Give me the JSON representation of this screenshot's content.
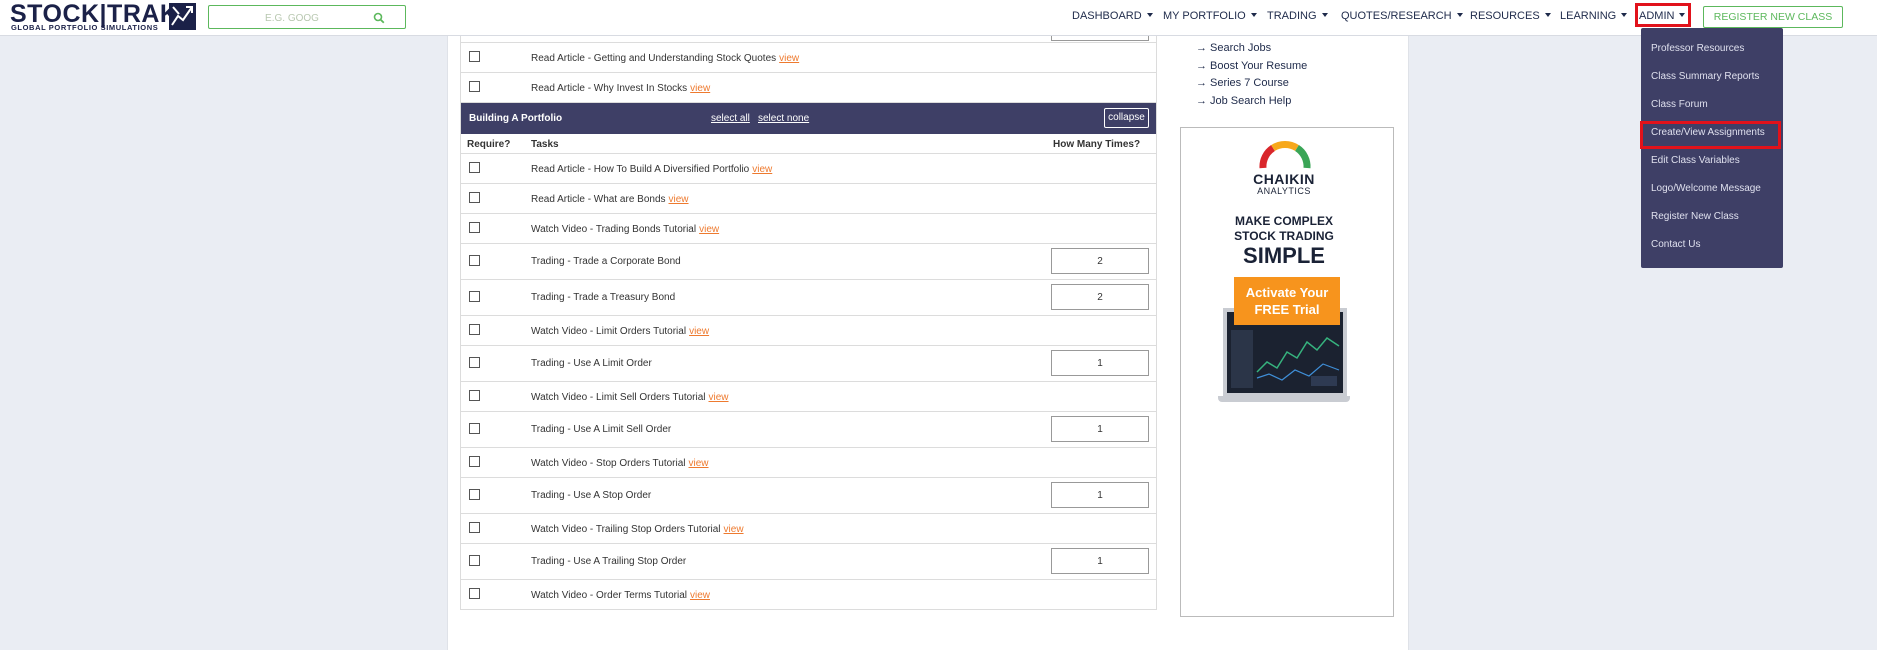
{
  "logo": {
    "word": "STOCK|TRAK",
    "tagline": "GLOBAL PORTFOLIO SIMULATIONS"
  },
  "search": {
    "placeholder": "E.G. GOOG",
    "icon": "search-icon"
  },
  "nav": {
    "items": [
      "DASHBOARD",
      "MY PORTFOLIO",
      "TRADING",
      "QUOTES/RESEARCH",
      "RESOURCES",
      "LEARNING",
      "ADMIN"
    ],
    "register_label": "REGISTER NEW CLASS"
  },
  "admin_menu": {
    "items": [
      "Professor Resources",
      "Class Summary Reports",
      "Class Forum",
      "Create/View Assignments",
      "Edit Class Variables",
      "Logo/Welcome Message",
      "Register New Class",
      "Contact Us"
    ],
    "highlighted": "Create/View Assignments"
  },
  "tasks_before": [
    {
      "text": "Read Article - Getting and Understanding Stock Quotes",
      "link": "view"
    },
    {
      "text": "Read Article - Why Invest In Stocks",
      "link": "view"
    }
  ],
  "section": {
    "title": "Building A Portfolio",
    "select_all": "select all",
    "select_none": "select none",
    "collapse": "collapse",
    "columns": {
      "require": "Require?",
      "tasks": "Tasks",
      "times": "How Many Times?"
    },
    "tasks": [
      {
        "text": "Read Article - How To Build A Diversified Portfolio",
        "link": "view",
        "times": null
      },
      {
        "text": "Read Article - What are Bonds",
        "link": "view",
        "times": null
      },
      {
        "text": "Watch Video - Trading Bonds Tutorial",
        "link": "view",
        "times": null
      },
      {
        "text": "Trading - Trade a Corporate Bond",
        "link": null,
        "times": "2"
      },
      {
        "text": "Trading - Trade a Treasury Bond",
        "link": null,
        "times": "2"
      },
      {
        "text": "Watch Video - Limit Orders Tutorial",
        "link": "view",
        "times": null
      },
      {
        "text": "Trading - Use A Limit Order",
        "link": null,
        "times": "1"
      },
      {
        "text": "Watch Video - Limit Sell Orders Tutorial",
        "link": "view",
        "times": null
      },
      {
        "text": "Trading - Use A Limit Sell Order",
        "link": null,
        "times": "1"
      },
      {
        "text": "Watch Video - Stop Orders Tutorial",
        "link": "view",
        "times": null
      },
      {
        "text": "Trading - Use A Stop Order",
        "link": null,
        "times": "1"
      },
      {
        "text": "Watch Video - Trailing Stop Orders Tutorial",
        "link": "view",
        "times": null
      },
      {
        "text": "Trading - Use A Trailing Stop Order",
        "link": null,
        "times": "1"
      },
      {
        "text": "Watch Video - Order Terms Tutorial",
        "link": "view",
        "times": null
      }
    ]
  },
  "sidebar_links": [
    "Search Jobs",
    "Boost Your Resume",
    "Series 7 Course",
    "Job Search Help"
  ],
  "ad": {
    "brand": "CHAIKIN",
    "brand_sub": "ANALYTICS",
    "headline_1": "MAKE COMPLEX",
    "headline_2": "STOCK TRADING",
    "headline_3": "SIMPLE",
    "cta": "Activate Your FREE Trial"
  },
  "colors": {
    "navy": "#3e3f66",
    "accent_link": "#ee7a2f",
    "green": "#5cb85c",
    "highlight": "#e1121b"
  }
}
